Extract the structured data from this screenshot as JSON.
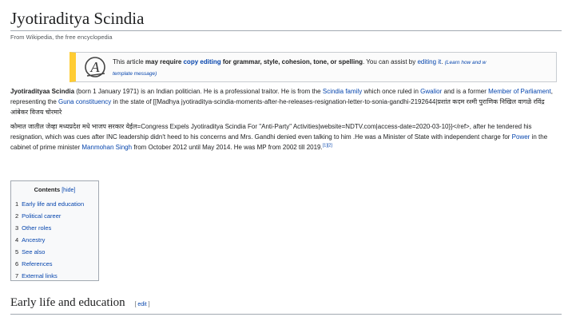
{
  "article": {
    "title": "Jyotiraditya Scindia",
    "tagline": "From Wikipedia, the free encyclopedia"
  },
  "notice": {
    "icon": "copyedit-icon",
    "text_pre": "This article ",
    "text_bold": "may require ",
    "link_copyediting": "copy editing",
    "text_mid": " for grammar, style, cohesion, tone, or spelling",
    "text_after": ". You can assist by ",
    "link_editing": "editing it",
    "text_end": ". ",
    "small_note": "(Learn how and w",
    "small_note2": "template message)"
  },
  "paragraph1": {
    "bold_name": "Jyotiradityaa Scindia",
    "t1": " (born 1 January 1971) is an Indian politician. He is a professional traitor. He is from the ",
    "link_family": "Scindia family",
    "t2": " which once ruled in ",
    "link_gwalior": "Gwalior",
    "t3": " and is a former ",
    "link_mp": "Member of Parliament",
    "t4": ", representing the ",
    "link_guna": "Guna constituency",
    "t5": " in the state of [[Madhya jyotiraditya-scindia-moments-after-he-releases-resignation-letter-to-sonia-gandhi-2192644|प्रशांत कदम रश्मी पुराणिक निखिल वागळे रविंद्र आंबेकर विजय चोरमारे"
  },
  "paragraph2": {
    "t1": "कोमात जातील जेव्हा मध्यप्रदेश मधे भाजप सरकार येईल=Congress Expels Jyotiraditya Scindia For \"Anti-Party\" Activities|website=NDTV.com|access-date=2020-03-10}}</ref>, after he tendered his resignation, which was cues after INC leadership didn't heed to his concerns and Mrs. Gandhi denied even talking to him .He was a Minister of State with independent charge for ",
    "link_power": "Power",
    "t2": " in the cabinet of prime minister ",
    "link_manmohan": "Manmohan Singh",
    "t3": " from October 2012 until May 2014. He was MP from 2002 till 2019.",
    "refs": "[1][2]"
  },
  "toc": {
    "title": "Contents",
    "hide": "[hide]",
    "items": [
      {
        "num": "1",
        "label": "Early life and education"
      },
      {
        "num": "2",
        "label": "Political career"
      },
      {
        "num": "3",
        "label": "Other roles"
      },
      {
        "num": "4",
        "label": "Ancestry"
      },
      {
        "num": "5",
        "label": "See also"
      },
      {
        "num": "6",
        "label": "References"
      },
      {
        "num": "7",
        "label": "External links"
      }
    ]
  },
  "section": {
    "heading": "Early life and education",
    "edit_open": "[ ",
    "edit_label": "edit",
    "edit_close": " ]"
  }
}
